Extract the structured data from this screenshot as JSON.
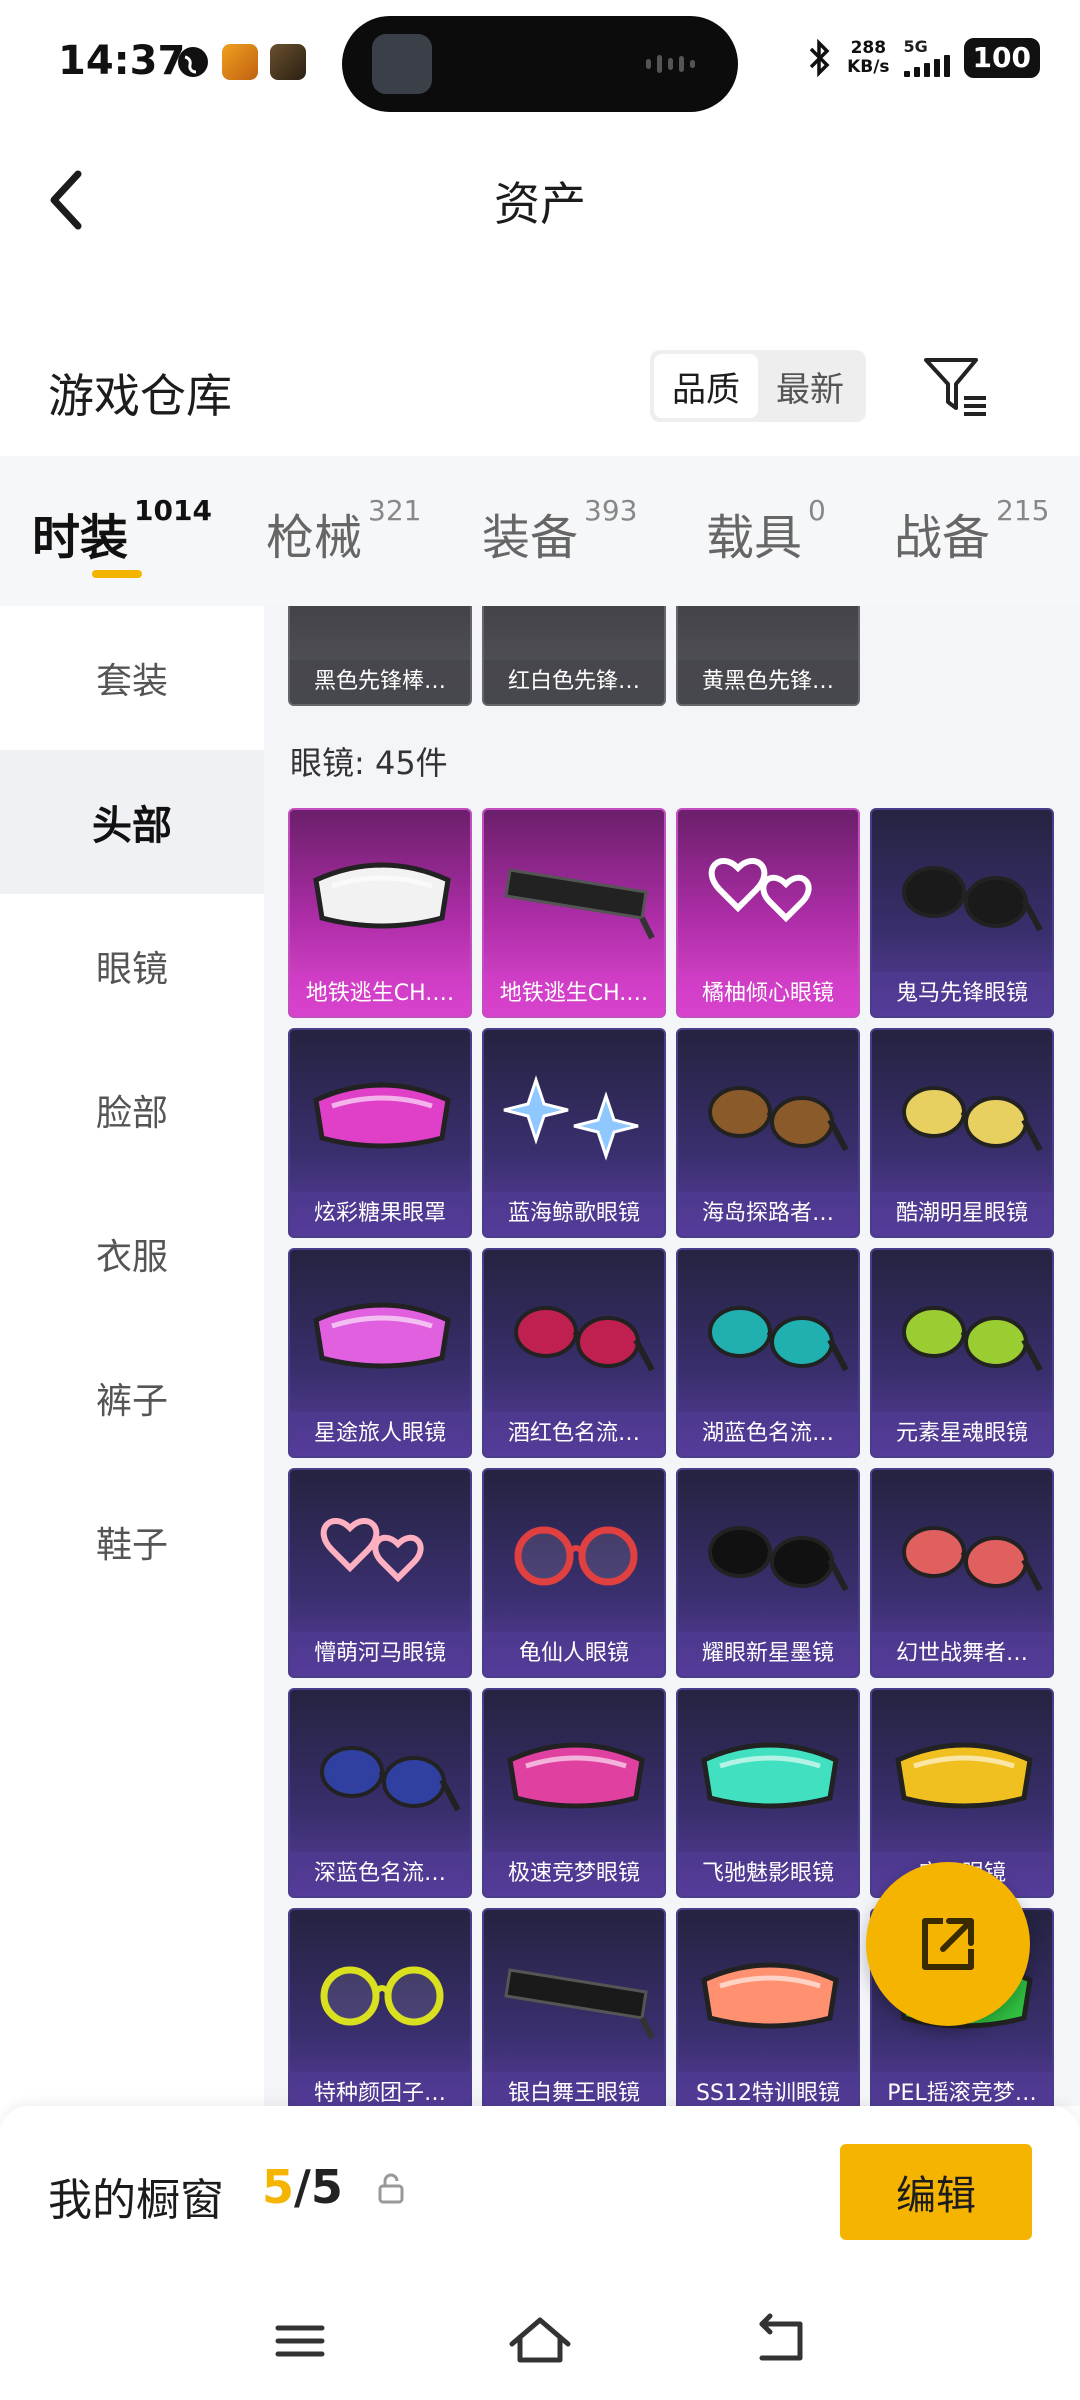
{
  "status_bar": {
    "time": "14:37",
    "net_speed_value": "288",
    "net_speed_unit": "KB/s",
    "network_type": "5G",
    "battery": "100"
  },
  "header": {
    "title": "资产"
  },
  "warehouse": {
    "title": "游戏仓库",
    "sort_options": [
      "品质",
      "最新"
    ],
    "sort_selected": "品质"
  },
  "categories": [
    {
      "label": "时装",
      "count": "1014",
      "active": true
    },
    {
      "label": "枪械",
      "count": "321"
    },
    {
      "label": "装备",
      "count": "393"
    },
    {
      "label": "载具",
      "count": "0"
    },
    {
      "label": "战备",
      "count": "215"
    }
  ],
  "sidebar": {
    "items": [
      {
        "label": "套装"
      },
      {
        "label": "头部",
        "active": true
      },
      {
        "label": "眼镜"
      },
      {
        "label": "脸部"
      },
      {
        "label": "衣服"
      },
      {
        "label": "裤子"
      },
      {
        "label": "鞋子"
      }
    ]
  },
  "previous_row": [
    {
      "label": "黑色先锋棒…"
    },
    {
      "label": "红白色先锋…"
    },
    {
      "label": "黄黑色先锋…"
    }
  ],
  "section": {
    "label": "眼镜: 45件"
  },
  "items": [
    {
      "label": "地铁逃生CH.…",
      "style": "pink",
      "icon": "ski-goggles-white-icon",
      "color": "#f2f2f2"
    },
    {
      "label": "地铁逃生CH.…",
      "style": "pink",
      "icon": "shield-sunglasses-black-icon",
      "color": "#222222"
    },
    {
      "label": "橘柚倾心眼镜",
      "style": "pink",
      "icon": "heart-glasses-white-icon",
      "color": "#ffffff"
    },
    {
      "label": "鬼马先锋眼镜",
      "style": "purple",
      "icon": "sunglasses-black-icon",
      "color": "#1a1a1a"
    },
    {
      "label": "炫彩糖果眼罩",
      "style": "purple",
      "icon": "candy-eyemask-pink-icon",
      "color": "#e040c8"
    },
    {
      "label": "蓝海鲸歌眼镜",
      "style": "purple",
      "icon": "star-glasses-blue-icon",
      "color": "#8ec8ff"
    },
    {
      "label": "海岛探路者…",
      "style": "purple",
      "icon": "aviator-brown-icon",
      "color": "#8a5a2a"
    },
    {
      "label": "酷潮明星眼镜",
      "style": "purple",
      "icon": "aviator-gold-icon",
      "color": "#e8d060"
    },
    {
      "label": "星途旅人眼镜",
      "style": "purple",
      "icon": "visor-pink-icon",
      "color": "#e060e0"
    },
    {
      "label": "酒红色名流…",
      "style": "purple",
      "icon": "aviator-wine-icon",
      "color": "#c02050"
    },
    {
      "label": "湖蓝色名流…",
      "style": "purple",
      "icon": "aviator-teal-icon",
      "color": "#20b0b0"
    },
    {
      "label": "元素星魂眼镜",
      "style": "purple",
      "icon": "sunglasses-green-icon",
      "color": "#9acd32"
    },
    {
      "label": "懵萌河马眼镜",
      "style": "purple",
      "icon": "heart-glasses-pink-icon",
      "color": "#ffb0c0"
    },
    {
      "label": "龟仙人眼镜",
      "style": "purple",
      "icon": "round-glasses-red-icon",
      "color": "#e04040"
    },
    {
      "label": "耀眼新星墨镜",
      "style": "purple",
      "icon": "sunglasses-dark-icon",
      "color": "#111111"
    },
    {
      "label": "幻世战舞者…",
      "style": "purple",
      "icon": "sunglasses-sunset-icon",
      "color": "#e06060"
    },
    {
      "label": "深蓝色名流…",
      "style": "purple",
      "icon": "aviator-navy-icon",
      "color": "#3040a0"
    },
    {
      "label": "极速竞梦眼镜",
      "style": "purple",
      "icon": "visor-magenta-icon",
      "color": "#e040a0"
    },
    {
      "label": "飞驰魅影眼镜",
      "style": "purple",
      "icon": "visor-cyan-icon",
      "color": "#40e0c0"
    },
    {
      "label": "庆…眼镜",
      "style": "purple",
      "icon": "ski-goggles-gold-icon",
      "color": "#f0c020"
    },
    {
      "label": "特种颜团子…",
      "style": "purple",
      "icon": "round-glasses-yellow-icon",
      "color": "#d8e020"
    },
    {
      "label": "银白舞王眼镜",
      "style": "purple",
      "icon": "shield-sunglasses-dark-icon",
      "color": "#1a1a1a"
    },
    {
      "label": "SS12特训眼镜",
      "style": "purple",
      "icon": "ski-goggles-rainbow-icon",
      "color": "#ff9070"
    },
    {
      "label": "PEL摇滚竞梦…",
      "style": "purple",
      "icon": "goggles-green-icon",
      "color": "#30c040"
    }
  ],
  "fab": {
    "icon": "share-external-icon"
  },
  "showcase": {
    "title": "我的橱窗",
    "count": "5",
    "separator": "/",
    "total": "5",
    "edit_label": "编辑"
  },
  "colors": {
    "accent": "#f5b400",
    "card_purple": "#3a2f6e",
    "card_pink": "#b02eaa"
  }
}
